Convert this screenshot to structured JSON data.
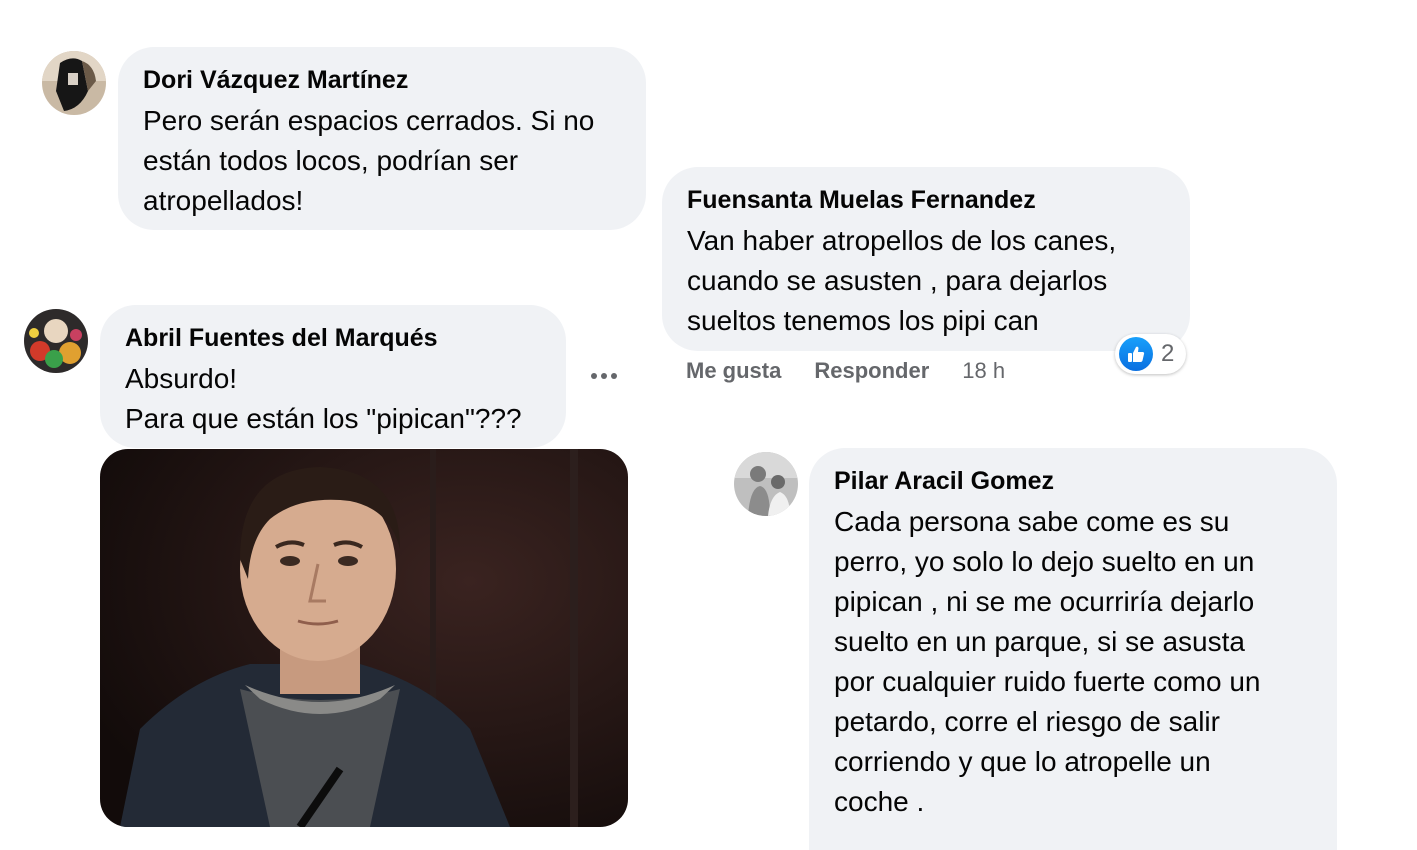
{
  "comments": [
    {
      "author": "Dori Vázquez Martínez",
      "text": "Pero serán espacios cerrados. Si no\nestán todos locos, podrían ser\natropellados!"
    },
    {
      "author": "Fuensanta Muelas Fernandez",
      "text": "Van haber atropellos de los canes,\ncuando se asusten , para dejarlos\nsueltos tenemos los pipi can",
      "actions": {
        "like": "Me gusta",
        "reply": "Responder",
        "time": "18 h"
      },
      "reactions": {
        "icon": "thumbs-up-icon",
        "count": "2",
        "color": "#1877f2"
      }
    },
    {
      "author": "Abril Fuentes del Marqués",
      "text": "Absurdo!\nPara que están los \"pipican\"???",
      "media": {
        "type": "gif"
      }
    },
    {
      "author": "Pilar Aracil Gomez",
      "text": "Cada persona sabe come es su\nperro, yo solo lo dejo suelto en un\npipican , ni se me ocurriría dejarlo\nsuelto en un parque, si se asusta\npor cualquier ruido fuerte como un\npetardo, corre el riesgo de salir\ncorriendo y que lo atropelle un\ncoche ."
    }
  ],
  "colors": {
    "bubble": "#f0f2f5",
    "meta_text": "#65676b",
    "like_blue": "#1877f2"
  }
}
